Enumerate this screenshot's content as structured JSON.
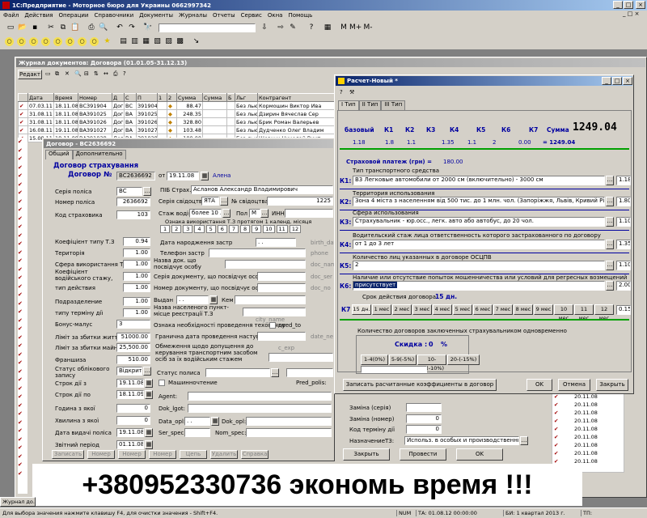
{
  "app": {
    "title": "1С:Предприятие - Моторное бюро для Украины 0662997342"
  },
  "menu": [
    "Файл",
    "Действия",
    "Операции",
    "Справочники",
    "Документы",
    "Журналы",
    "Отчеты",
    "Сервис",
    "Окна",
    "Помощь"
  ],
  "toolbar": {
    "m_labels": [
      "M",
      "M+",
      "M-"
    ]
  },
  "journal": {
    "title": "Журнал документов: Договора (01.01.05-31.12.13)",
    "buttons": [
      "Редакт"
    ],
    "columns": [
      "",
      "Дата",
      "Время",
      "Номер",
      "Д",
      "С",
      "П",
      "1",
      "2",
      "Сумма",
      "Сумма",
      "Б",
      "Льг",
      "Контрагент"
    ],
    "rows": [
      [
        "07.03.11",
        "18.11.08",
        "ВС391904",
        "Дог",
        "ВС",
        "391904",
        "88.47",
        "Без лью",
        "Кормошин Виктор Ива"
      ],
      [
        "31.08.11",
        "18.11.08",
        "ВА391025",
        "Дог",
        "ВА",
        "391025",
        "248.35",
        "Без лью",
        "Дзирин Вячеслав Сер"
      ],
      [
        "31.08.11",
        "18.11.08",
        "ВА391026",
        "Дог",
        "ВА",
        "391026",
        "328.80",
        "Без лью",
        "Брик Роман Валерьев"
      ],
      [
        "16.08.11",
        "19.11.08",
        "ВА391027",
        "Дог",
        "ВА",
        "391027",
        "103.48",
        "Без лью",
        "Дудченко Олег Владим"
      ],
      [
        "15.08.11",
        "18.11.08",
        "ВА391028",
        "Дог",
        "ВА",
        "391028",
        "100.00",
        "Без лью",
        "Шевчук Николай Викт"
      ]
    ],
    "side_dates": [
      "20.11.08",
      "20.11.08",
      "20.11.08",
      "20.11.08",
      "20.11.08",
      "20.11.08",
      "20.11.08",
      "20.11.08",
      "20.11.08"
    ]
  },
  "dogovor": {
    "title": "Договор - ВС2636692",
    "tabs": [
      "Общий",
      "Дополнительно"
    ],
    "header": "Договор страхування",
    "label_dogovor": "Договор №",
    "number": "ВС2636692",
    "label_from": "от",
    "date": "19.11.08",
    "agent_name": "Алена",
    "labels": {
      "seria_polisa": "Серія поліса",
      "nomer_polisa": "Номер поліса",
      "kod_strahovika": "Код страховика",
      "pib": "ПІБ Страх.",
      "seria_svid": "Серія свідоцтва",
      "nomer_svid": "№ свідоцтва",
      "stazh": "Стаж водія",
      "pol": "Пол",
      "inn": "ИНН",
      "oznaka": "Ознака використання Т.З протягом 1 календ. місяця",
      "koef_tz": "Коефіцієнт типу Т.З",
      "territoria": "Територія",
      "sfera": "Сфера використання Т.З",
      "koef_stazh": "Коефіцієнт водійського стажу,",
      "tip_deistvia": "тип действия",
      "podrazdelenie": "Подразделение",
      "tip_terminu": "типу терміну дії",
      "bonus": "Бонус-малус",
      "limit_life": "Ліміт за збитки життю",
      "limit_property": "Ліміт за збитки майну",
      "franshiza": "Франшиза",
      "status_ucheta": "Статус облікового запису",
      "srok_s": "Строк дії з",
      "srok_po": "Строк дії по",
      "godina": "Година з якої",
      "hvilina": "Хвилина з якої",
      "data_vidachi": "Дата видачі поліса",
      "zvitnyi": "Звітний період",
      "data_rozhd": "Дата народження застр",
      "telefon": "Телефон застр",
      "nazva_doc": "Назва док. що посвідчує особу",
      "seria_doc": "Серія документу, що посвідчує особи",
      "nomer_doc": "Номер документу, що посвідчує особи",
      "vidan": "Выдан",
      "kem": "Кем",
      "naselenny": "Назва населеного пункт-місце реєстрації Т.З",
      "oznaka_techogl": "Ознака необхідності проведення техогляду",
      "need_to": "need_to",
      "granichna": "Гранична дата проведення наступного",
      "obmezhennya": "Обмеження щодо допущення до керування транспортним засобом осіб за їх водійським стажем",
      "status_polisa": "Статус полиса",
      "mashinnoe": "Машинночтение",
      "pred_polis": "Pred_polis:",
      "agent": "Agent:",
      "dok_lgot": "Dok_lgot:",
      "data_opl": "Data_opl:",
      "dok_opl": "Dok_opl:",
      "ser_spec": "Ser_spec:",
      "nom_spec": "Nom_spec:",
      "birth_dat": "birth_dat",
      "phone": "phone",
      "doc_nam": "doc_nam",
      "doc_ser": "doc_ser",
      "doc_no": "doc_no",
      "city_name": "city_name",
      "date_next": "date_ne",
      "c_exp": "c_exp"
    },
    "values": {
      "seria_polisa": "ВС",
      "nomer_polisa": "2636692",
      "kod_strahovika": "103",
      "pib": "Асланов Александр Владимирович",
      "seria_svid": "ЯТА",
      "nomer_svid": "1225",
      "stazh": "более 10 лет",
      "pol": "М",
      "koef_tz": "0.94",
      "territoria": "1.00",
      "sfera": "1.00",
      "koef_stazh": "1.00",
      "tip_deistvia": "1.00",
      "podrazdelenie": "1.00",
      "tip_terminu": "1.00",
      "bonus": "3",
      "limit_life": "51000.00",
      "limit_property": "25,500.00",
      "franshiza": "510.00",
      "status_ucheta": "Відкрита",
      "srok_s": "19.11.08",
      "srok_po": "18.11.09",
      "godina": "0",
      "hvilina": "0",
      "data_vidachi": "19.11.08",
      "zvitnyi": "01.11.08",
      "data_rozhd": ". .",
      "vidan": ". .",
      "data_opl": ". ."
    },
    "months": [
      "1",
      "2",
      "3",
      "4",
      "5",
      "6",
      "7",
      "8",
      "9",
      "10",
      "11",
      "12"
    ],
    "bottom_buttons": [
      "Записать",
      "Номер",
      "Номер",
      "Номер",
      "Цепь",
      "Удалить",
      "Справка"
    ]
  },
  "raschet": {
    "title": "Расчет-Новый *",
    "tabs": [
      "I Тип",
      "II Тип",
      "III Тип"
    ],
    "coef_headers": [
      "базовый",
      "К1",
      "К2",
      "К3",
      "К4",
      "К5",
      "К6",
      "К7",
      "Сумма"
    ],
    "coef_values": [
      "1.18",
      "1.8",
      "1.1",
      "1.35",
      "1.1",
      "2",
      "0.00"
    ],
    "sum_result": "= 1249.04",
    "sum_big": "1249.04",
    "strah_platezh_label": "Страховой платеж (грн) =",
    "strah_platezh_value": "180.00",
    "k_rows": [
      {
        "key": "К1:",
        "caption": "Тип транспортного средства",
        "value": "В3 Легковые автомобили от 2000 см (включительно) - 3000 см",
        "coef": "1.18"
      },
      {
        "key": "К2:",
        "caption": "Территория использования",
        "value": "Зона 4    міста з населенням від 500 тис. до 1 млн. чол. (Запоріжжя, Львів, Кривий Ріг, Миколаїв)",
        "coef": "1.80"
      },
      {
        "key": "К3:",
        "caption": "Сфера использования",
        "value": "Страхувальник - юр.осс., легк. авто або автобус, до 20 чол.",
        "coef": "1.10"
      },
      {
        "key": "К4:",
        "caption": "Водительский стаж лица ответственность  которого застрахованного по договору",
        "value": "от 1 до 3 лет",
        "coef": "1.35"
      },
      {
        "key": "К5:",
        "caption": "Количество лиц указанных в договоре ОСЦПВ",
        "value": "2",
        "coef": "1.10"
      },
      {
        "key": "К6:",
        "caption": "Наличие или отсутствие попыток мошенничества или условий для регресных возмещений",
        "value": "присутствует",
        "coef": "2.00"
      }
    ],
    "srok_label": "Срок действия договора",
    "srok_value": "15 дн.",
    "k7_label": "К7",
    "k7_buttons": [
      "15 дн.",
      "1 мес",
      "2 мес",
      "3 мес",
      "4 мес",
      "5 мес",
      "6 мес",
      "7 мес",
      "8 мес",
      "9 мес",
      "10 мес",
      "11 мес",
      "12 мес"
    ],
    "k7_value": "0.15",
    "kolvo_label": "Количество договоров заключенных страхувальником одновременно",
    "skidka_label": "Скидка :",
    "skidka_value": "0",
    "skidka_pct": "%",
    "skidka_buttons": [
      "1-4(0%)",
      "5-9(-5%)",
      "10-19(-10%)",
      "20-(-15%)"
    ],
    "save_coef_button": "Записать расчитанные коэффициенты в договор",
    "ok": "OK",
    "cancel": "Отмена",
    "close": "Закрыть"
  },
  "lower_panel": {
    "zamina_seria": "Заміна (серія)",
    "zamina_nomer": "Заміна (номер)",
    "zamina_nomer_value": "0",
    "kod_terminu": "Код терміну дії",
    "kod_terminu_value": "0",
    "naznachenie": "НазначениеТЗ:",
    "naznachenie_value": "Использ. в особых и производственных целях",
    "buttons": [
      "Закрыть",
      "Провести",
      "OK"
    ]
  },
  "banner": {
    "text": "+380952330736 экономь время !!!"
  },
  "statusbar": {
    "hint": "Для выбора значения нажмите клавишу F4, для очистки значения - Shift+F4.",
    "num": "NUM",
    "ta": "ТА: 01.08.12  00:00:00",
    "bi": "БИ: 1 квартал 2013 г.",
    "tp": "ТП:"
  },
  "taskbar": {
    "item": "Журнал до..."
  },
  "colors": {
    "title_active": "#0a246a",
    "title_gradient": "#a6caf0",
    "window_bg": "#d4d0c8",
    "header_blue": "#0000a0",
    "banner_bg": "#ffffff"
  }
}
